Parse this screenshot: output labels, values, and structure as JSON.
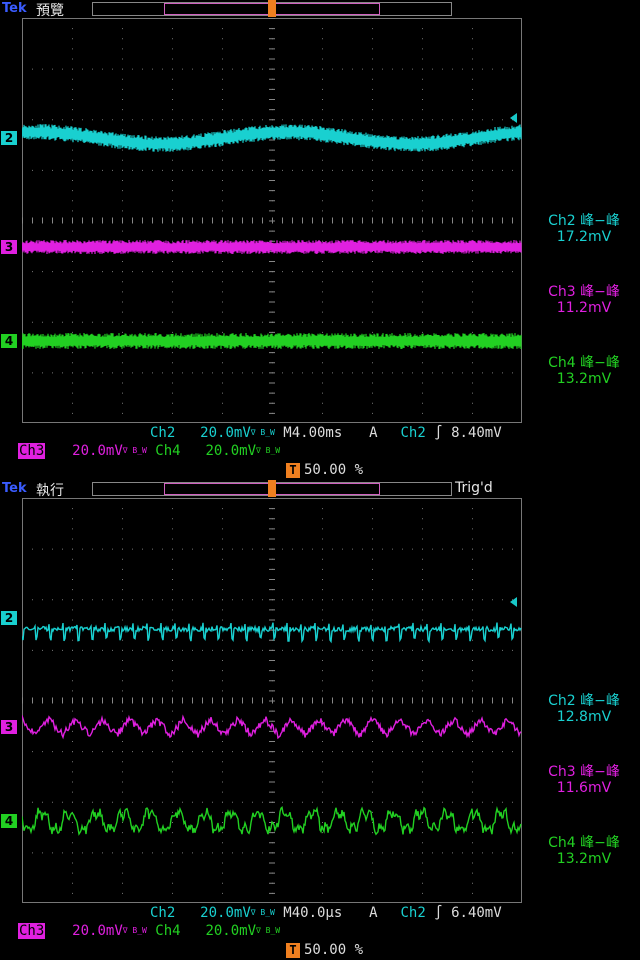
{
  "colors": {
    "ch2": "#19d0d0",
    "ch3": "#e020e0",
    "ch4": "#22d022",
    "trigger": "#f08020",
    "brand": "#3a5cff"
  },
  "brand": "Tek",
  "panels": [
    {
      "mode": "預覽",
      "trigd": "",
      "channel_markers": [
        "2",
        "3",
        "4"
      ],
      "measurements": [
        {
          "label": "Ch2 峰−峰",
          "value": "17.2mV"
        },
        {
          "label": "Ch3 峰−峰",
          "value": "11.2mV"
        },
        {
          "label": "Ch4 峰−峰",
          "value": "13.2mV"
        }
      ],
      "status": {
        "ch2_name": "Ch2",
        "ch2_scale": "20.0mV",
        "ch3_name": "Ch3",
        "ch3_scale": "20.0mV",
        "ch4_name": "Ch4",
        "ch4_scale": "20.0mV",
        "timebase": "M4.00ms",
        "trig_mode": "A",
        "trig_src": "Ch2",
        "trig_slope": "∫",
        "trig_level": "8.40mV",
        "trig_pos": "50.00 %",
        "bw_glyph": "∇ B_W"
      }
    },
    {
      "mode": "執行",
      "trigd": "Trig'd",
      "channel_markers": [
        "2",
        "3",
        "4"
      ],
      "measurements": [
        {
          "label": "Ch2 峰−峰",
          "value": "12.8mV"
        },
        {
          "label": "Ch3 峰−峰",
          "value": "11.6mV"
        },
        {
          "label": "Ch4 峰−峰",
          "value": "13.2mV"
        }
      ],
      "status": {
        "ch2_name": "Ch2",
        "ch2_scale": "20.0mV",
        "ch3_name": "Ch3",
        "ch3_scale": "20.0mV",
        "ch4_name": "Ch4",
        "ch4_scale": "20.0mV",
        "timebase": "M40.0µs",
        "trig_mode": "A",
        "trig_src": "Ch2",
        "trig_slope": "∫",
        "trig_level": "6.40mV",
        "trig_pos": "50.00 %",
        "bw_glyph": "∇ B_W"
      }
    }
  ]
}
